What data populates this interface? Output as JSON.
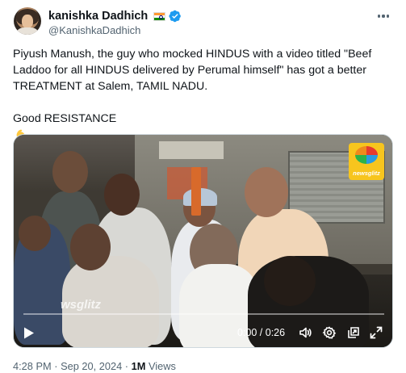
{
  "author": {
    "display_name": "kanishka Dadhich",
    "handle": "@KanishkaDadhich",
    "flag_icon": "india-flag-icon",
    "verified_icon": "verified-badge-icon"
  },
  "tweet": {
    "paragraph_1": "Piyush Manush, the guy who mocked HINDUS with a video titled \"Beef\nLaddoo for all HINDUS delivered by Perumal himself\" has got a better\nTREATMENT at Salem, TAMIL NADU.",
    "paragraph_2": "Good RESISTANCE"
  },
  "video": {
    "watermark": "wsglitz",
    "logo_text": "newsglitz",
    "time": "0:00 / 0:26",
    "progress": 0.0
  },
  "meta": {
    "time": "4:28 PM",
    "date": "Sep 20, 2024",
    "views_count": "1M",
    "views_label": "Views",
    "separator": "·"
  },
  "colors": {
    "accent": "#1d9bf0",
    "text_primary": "#0f1419",
    "text_secondary": "#536471"
  }
}
